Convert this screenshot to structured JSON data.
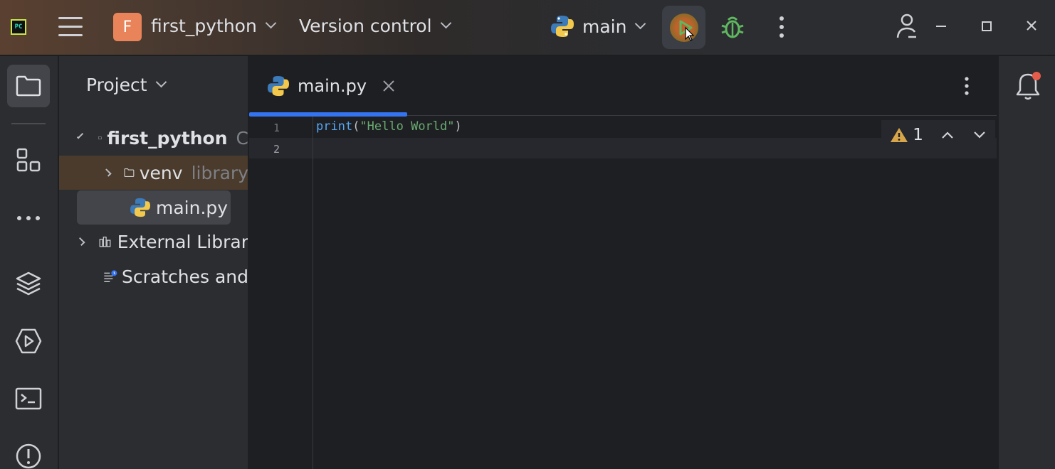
{
  "titlebar": {
    "project_initial": "F",
    "project_name": "first_python",
    "vcs_label": "Version control",
    "run_config": "main"
  },
  "sidebar": {
    "title": "Project",
    "tree": {
      "root": {
        "name": "first_python",
        "hint": "C"
      },
      "venv": {
        "name": "venv",
        "hint": "library"
      },
      "file": {
        "name": "main.py"
      },
      "external": {
        "name": "External Librar"
      },
      "scratches": {
        "name": "Scratches and"
      }
    }
  },
  "editor": {
    "tab_label": "main.py",
    "line_numbers": [
      "1",
      "2"
    ],
    "code": {
      "fn": "print",
      "open": "(",
      "str": "\"Hello World\"",
      "close": ")"
    },
    "warnings_count": "1"
  },
  "colors": {
    "accent": "#3574f0",
    "project_badge": "#e9845a",
    "debug": "#5fb85f",
    "notification": "#e55d4a"
  }
}
